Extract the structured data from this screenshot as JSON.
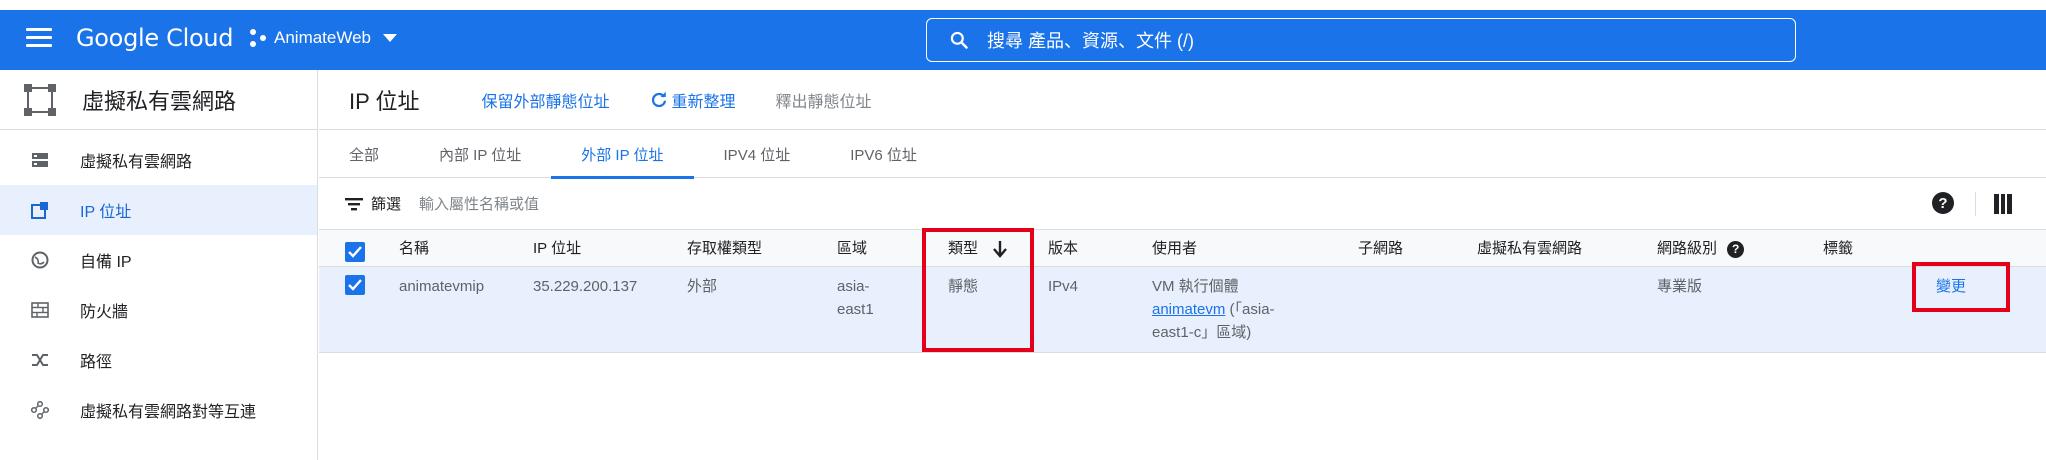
{
  "topbar": {
    "brand": "Google Cloud",
    "project": "AnimateWeb",
    "search_placeholder": "搜尋  產品、資源、文件 (/)"
  },
  "sidebar": {
    "title": "虛擬私有雲網路",
    "items": [
      {
        "label": "虛擬私有雲網路",
        "icon": "vpc-network-icon"
      },
      {
        "label": "IP 位址",
        "icon": "ip-address-icon"
      },
      {
        "label": "自備 IP",
        "icon": "globe-icon"
      },
      {
        "label": "防火牆",
        "icon": "firewall-icon"
      },
      {
        "label": "路徑",
        "icon": "routes-icon"
      },
      {
        "label": "虛擬私有雲網路對等互連",
        "icon": "peering-icon"
      }
    ]
  },
  "page": {
    "title": "IP 位址",
    "actions": {
      "reserve": "保留外部靜態位址",
      "refresh": "重新整理",
      "release": "釋出靜態位址"
    }
  },
  "tabs": [
    "全部",
    "內部 IP 位址",
    "外部 IP 位址",
    "IPV4 位址",
    "IPV6 位址"
  ],
  "filter": {
    "label": "篩選",
    "placeholder": "輸入屬性名稱或值"
  },
  "table": {
    "headers": {
      "name": "名稱",
      "ip": "IP 位址",
      "access_type": "存取權類型",
      "region": "區域",
      "type": "類型",
      "version": "版本",
      "used_by": "使用者",
      "subnet": "子網路",
      "vpc": "虛擬私有雲網路",
      "tier": "網路級別",
      "labels": "標籤"
    },
    "row": {
      "name": "animatevmip",
      "ip": "35.229.200.137",
      "access_type": "外部",
      "region_1": "asia-",
      "region_2": "east1",
      "type": "靜態",
      "version": "IPv4",
      "used_by_prefix": "VM 執行個體",
      "used_by_link": "animatevm",
      "used_by_suffix_1": " (「asia-",
      "used_by_suffix_2": "east1-c」區域)",
      "tier": "專業版",
      "action": "變更"
    }
  },
  "colors": {
    "brand_blue": "#1a73e8",
    "selected_row": "#e8f0fe",
    "highlight_red": "#e5001a"
  }
}
